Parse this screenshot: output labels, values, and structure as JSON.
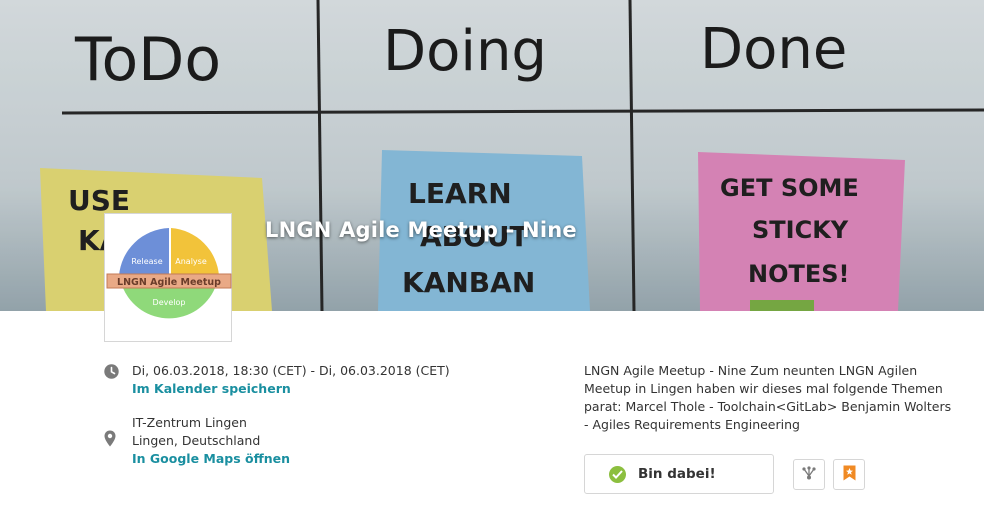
{
  "hero": {
    "title": "LNGN Agile Meetup - Nine",
    "board": {
      "col1": "ToDo",
      "col2": "Doing",
      "col3": "Done",
      "note1": [
        "USE",
        "KA"
      ],
      "note2": [
        "LEARN",
        "ABOUT",
        "KANBAN"
      ],
      "note3": [
        "GET SOME",
        "STICKY",
        "NOTES!"
      ]
    }
  },
  "logo": {
    "release": "Release",
    "analyse": "Analyse",
    "develop": "Develop",
    "banner": "LNGN Agile Meetup"
  },
  "details": {
    "date_text": "Di, 06.03.2018, 18:30 (CET) - Di, 06.03.2018 (CET)",
    "calendar_link": "Im Kalender speichern",
    "venue": "IT-Zentrum Lingen",
    "city": "Lingen, Deutschland",
    "maps_link": "In Google Maps öffnen"
  },
  "description": "LNGN Agile Meetup - Nine Zum neunten LNGN Agilen Meetup in Lingen haben wir dieses mal folgende Themen parat: Marcel Thole - Toolchain<GitLab> Benjamin Wolters - Agiles Requirements Engineering",
  "actions": {
    "join_label": "Bin dabei!",
    "share_icon": "share-icon",
    "bookmark_icon": "bookmark-icon"
  },
  "colors": {
    "accent_link": "#1a8fa0",
    "check_green": "#8cbf3f",
    "bookmark_orange": "#f08a24"
  }
}
